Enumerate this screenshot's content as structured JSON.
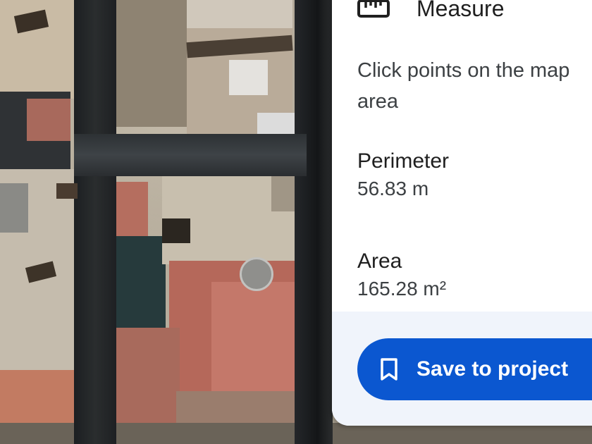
{
  "panel": {
    "icon": "ruler-icon",
    "title": "Measure",
    "instructions": "Click points on the map area"
  },
  "stats": {
    "perimeter_label": "Perimeter",
    "perimeter_value": "56.83 m",
    "area_label": "Area",
    "area_value": "165.28 m²"
  },
  "footer": {
    "save_label": "Save to project",
    "save_icon": "bookmark-icon"
  },
  "colors": {
    "accent": "#0b57d0",
    "footer_bg": "#f0f4fb",
    "panel_bg": "#ffffff"
  }
}
